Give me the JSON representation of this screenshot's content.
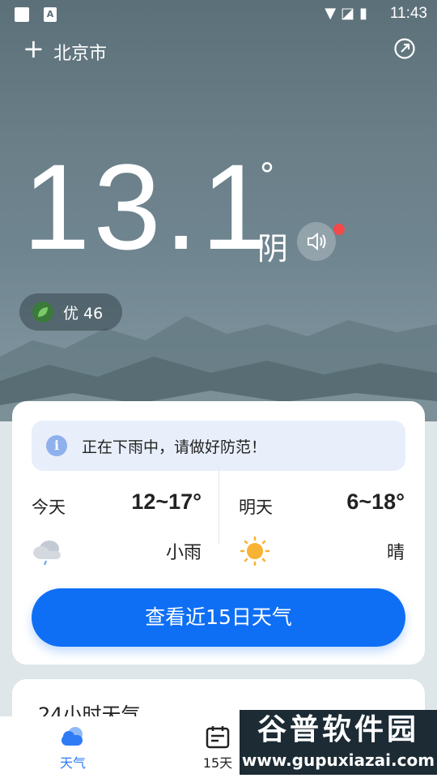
{
  "status_bar": {
    "time": "11:43",
    "icons": [
      "square-icon",
      "a-icon",
      "wifi-icon",
      "signal-off-icon",
      "battery-charging-icon"
    ]
  },
  "header": {
    "city": "北京市"
  },
  "current": {
    "temperature": "13.1",
    "degree": "°",
    "condition": "阴",
    "aqi_label": "优 46"
  },
  "alert": {
    "text": "正在下雨中，请做好防范！"
  },
  "forecast": {
    "today": {
      "label": "今天",
      "range": "12~17°",
      "weather": "小雨",
      "icon": "cloud-rain-icon"
    },
    "tomorrow": {
      "label": "明天",
      "range": "6~18°",
      "weather": "晴",
      "icon": "sun-icon"
    }
  },
  "buttons": {
    "fifteen_day": "查看近15日天气"
  },
  "hourly": {
    "title": "24小时天气"
  },
  "tabbar": {
    "weather": "天气",
    "fifteen": "15天"
  },
  "watermark": {
    "line1": "谷普软件园",
    "line2": "www.gupuxiazai.com"
  },
  "colors": {
    "accent": "#0e6ff5",
    "alert_bg": "#e8effb",
    "red_dot": "#f24a4a"
  }
}
